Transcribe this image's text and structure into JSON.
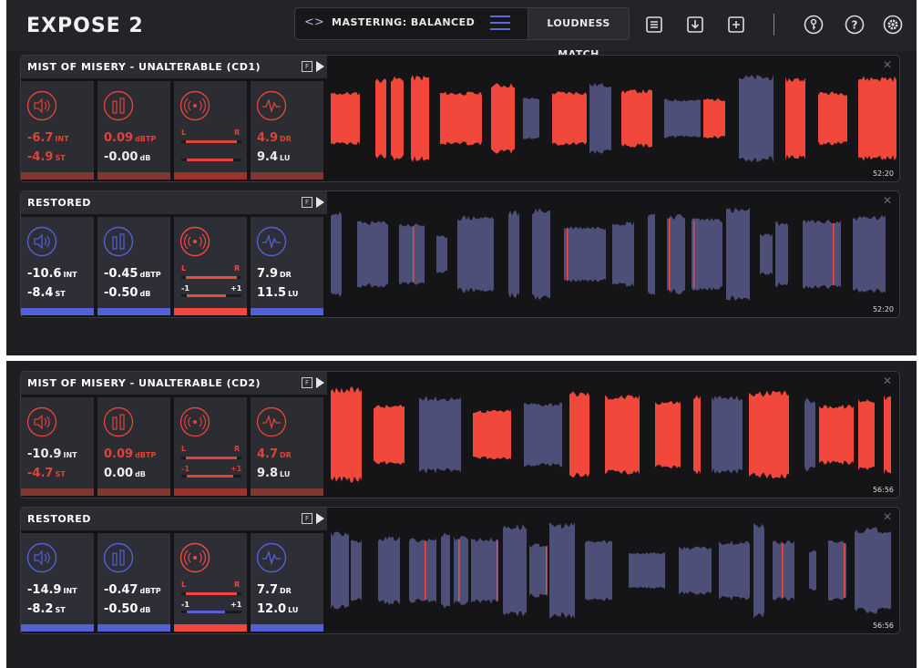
{
  "app_title": "EXPOSE 2",
  "preset": {
    "arrows": "<>",
    "name": "MASTERING: BALANCED"
  },
  "loudness_match": "LOUDNESS MATCH",
  "tracks": [
    {
      "title": "MIST OF MISERY - UNALTERABLE (CD1)",
      "f": "F",
      "time": "52:20",
      "original": true,
      "int": "-6.7",
      "st": "-4.9",
      "dbtp": "0.09",
      "db": "-0.00",
      "dr": "4.9",
      "lu": "9.4",
      "u_int": "INT",
      "u_st": "ST",
      "u_dbtp": "dBTP",
      "u_db": "dB",
      "u_dr": "DR",
      "u_lu": "LU",
      "l": "L",
      "r": "R",
      "m1": "",
      "p1": "",
      "red_int": true,
      "red_st": true,
      "red_dbtp": true,
      "red_db": false,
      "red_dr": true,
      "red_lu": false,
      "lvl": [
        0.74,
        0.72,
        0.85,
        0.28,
        0.74
      ],
      "seed": 11
    },
    {
      "title": "RESTORED",
      "f": "F",
      "time": "52:20",
      "original": false,
      "int": "-10.6",
      "st": "-8.4",
      "dbtp": "-0.45",
      "db": "-0.50",
      "dr": "7.9",
      "lu": "11.5",
      "u_int": "INT",
      "u_st": "ST",
      "u_dbtp": "dBTP",
      "u_db": "dB",
      "u_dr": "DR",
      "u_lu": "LU",
      "l": "L",
      "r": "R",
      "m1": "-1",
      "p1": "+1",
      "red_int": false,
      "red_st": false,
      "red_dbtp": false,
      "red_db": false,
      "red_dr": false,
      "red_lu": false,
      "lvl": [
        0.5,
        0.48,
        0.72,
        0.18,
        0.5
      ],
      "seed": 23
    },
    {
      "title": "MIST OF MISERY - UNALTERABLE (CD2)",
      "f": "F",
      "time": "56:56",
      "original": true,
      "int": "-10.9",
      "st": "-4.7",
      "dbtp": "0.09",
      "db": "0.00",
      "dr": "4.7",
      "lu": "9.8",
      "u_int": "INT",
      "u_st": "ST",
      "u_dbtp": "dBTP",
      "u_db": "dB",
      "u_dr": "DR",
      "u_lu": "LU",
      "l": "L",
      "r": "R",
      "m1": "-1",
      "p1": "+1",
      "red_int": false,
      "red_st": true,
      "red_dbtp": true,
      "red_db": false,
      "red_dr": true,
      "red_lu": false,
      "lvl": [
        0.7,
        0.72,
        0.85,
        0.3,
        0.7
      ],
      "seed": 37
    },
    {
      "title": "RESTORED",
      "f": "F",
      "time": "56:56",
      "original": false,
      "int": "-14.9",
      "st": "-8.2",
      "dbtp": "-0.47",
      "db": "-0.50",
      "dr": "7.7",
      "lu": "12.0",
      "u_int": "INT",
      "u_st": "ST",
      "u_dbtp": "dBTP",
      "u_db": "dB",
      "u_dr": "DR",
      "u_lu": "LU",
      "l": "L",
      "r": "R",
      "m1": "-1",
      "p1": "+1",
      "red_int": false,
      "red_st": false,
      "red_dbtp": false,
      "red_db": false,
      "red_dr": false,
      "red_lu": false,
      "lvl": [
        0.46,
        0.45,
        0.7,
        0.55,
        0.46
      ],
      "seed": 53
    }
  ],
  "colors": {
    "red": "#f2483c",
    "blue": "#5460d6",
    "wave_blue": "#4e4f78",
    "dim_red": "#8a3a35",
    "panel": "#2e2e36"
  },
  "icons": [
    "preset-arrows-icon",
    "menu-icon",
    "list-icon",
    "import-icon",
    "add-icon",
    "key-icon",
    "help-icon",
    "settings-icon",
    "speaker-icon",
    "meter-icon",
    "stereo-icon",
    "dynamics-icon",
    "play-icon"
  ]
}
